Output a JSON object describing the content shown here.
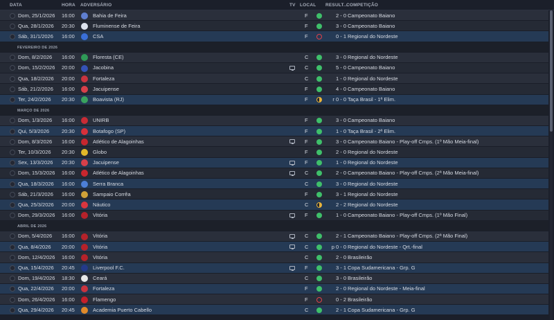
{
  "header": {
    "date": "DATA",
    "time": "HORA",
    "opponent": "ADVERSÁRIO",
    "tv": "TV",
    "local": "LOCAL",
    "result": "RESULT...",
    "competition": "COMPETIÇÃO"
  },
  "colors": {
    "win": "#3fbf6a",
    "draw": "#e7b23a",
    "loss": "#e0424a",
    "highlight_row": "#253a55"
  },
  "rows": [
    {
      "type": "match",
      "date": "Dom, 25/1/2026",
      "time": "16:00",
      "opponent": "Bahia de Feira",
      "badge_color": "#5f7fd0",
      "badge_icon": "crest-icon",
      "tv": false,
      "local": "F",
      "outcome": "win",
      "score": "2 - 0",
      "competition": "Campeonato Baiano"
    },
    {
      "type": "match",
      "date": "Qua, 28/1/2026",
      "time": "20:30",
      "opponent": "Fluminense de Feira",
      "badge_color": "#dce3ee",
      "badge_icon": "crest-icon",
      "tv": false,
      "local": "F",
      "outcome": "win",
      "score": "3 - 0",
      "competition": "Campeonato Baiano"
    },
    {
      "type": "match",
      "date": "Sáb, 31/1/2026",
      "time": "16:00",
      "opponent": "CSA",
      "badge_color": "#3a6fd8",
      "badge_icon": "crest-icon",
      "tv": false,
      "local": "F",
      "outcome": "loss",
      "score": "0 - 1",
      "competition": "Regional do Nordeste",
      "highlight": true
    },
    {
      "type": "month",
      "label": "FEVEREIRO DE 2026"
    },
    {
      "type": "match",
      "date": "Dom, 8/2/2026",
      "time": "16:00",
      "opponent": "Floresta (CE)",
      "badge_color": "#2f9a57",
      "badge_icon": "crest-icon",
      "tv": false,
      "local": "C",
      "outcome": "win",
      "score": "3 - 0",
      "competition": "Regional do Nordeste"
    },
    {
      "type": "match",
      "date": "Dom, 15/2/2026",
      "time": "20:00",
      "opponent": "Jacobina",
      "badge_color": "#3552b5",
      "badge_icon": "crest-icon",
      "tv": true,
      "local": "C",
      "outcome": "win",
      "score": "5 - 0",
      "competition": "Campeonato Baiano"
    },
    {
      "type": "match",
      "date": "Qua, 18/2/2026",
      "time": "20:00",
      "opponent": "Fortaleza",
      "badge_color": "#c9343f",
      "badge_icon": "crest-icon",
      "tv": false,
      "local": "C",
      "outcome": "win",
      "score": "1 - 0",
      "competition": "Regional do Nordeste"
    },
    {
      "type": "match",
      "date": "Sáb, 21/2/2026",
      "time": "16:00",
      "opponent": "Jacuipense",
      "badge_color": "#d8404a",
      "badge_icon": "crest-icon",
      "tv": false,
      "local": "F",
      "outcome": "win",
      "score": "4 - 0",
      "competition": "Campeonato Baiano"
    },
    {
      "type": "match",
      "date": "Ter, 24/2/2026",
      "time": "20:30",
      "opponent": "Boavista (RJ)",
      "badge_color": "#3aa35e",
      "badge_icon": "crest-icon",
      "tv": false,
      "local": "F",
      "outcome": "draw",
      "score": "r 0 - 0",
      "competition": "Taça Brasil - 1ª Elim.",
      "highlight": true
    },
    {
      "type": "month",
      "label": "MARÇO DE 2026"
    },
    {
      "type": "match",
      "date": "Dom, 1/3/2026",
      "time": "16:00",
      "opponent": "UNIRB",
      "badge_color": "#c92c35",
      "badge_icon": "crest-icon",
      "tv": false,
      "local": "F",
      "outcome": "win",
      "score": "3 - 0",
      "competition": "Campeonato Baiano"
    },
    {
      "type": "match",
      "date": "Qui, 5/3/2026",
      "time": "20:30",
      "opponent": "Botafogo (SP)",
      "badge_color": "#d8303a",
      "badge_icon": "crest-icon",
      "tv": false,
      "local": "F",
      "outcome": "win",
      "score": "1 - 0",
      "competition": "Taça Brasil - 2ª Elim.",
      "highlight": true
    },
    {
      "type": "match",
      "date": "Dom, 8/3/2026",
      "time": "16:00",
      "opponent": "Atlético de Alagoinhas",
      "badge_color": "#c8262e",
      "badge_icon": "crest-icon",
      "tv": true,
      "local": "F",
      "outcome": "win",
      "score": "3 - 0",
      "competition": "Campeonato Baiano - Play-off Cmps. (1º Mão Meia-final)"
    },
    {
      "type": "match",
      "date": "Ter, 10/3/2026",
      "time": "20:30",
      "opponent": "Globo",
      "badge_color": "#e1b829",
      "badge_icon": "crest-icon",
      "tv": false,
      "local": "F",
      "outcome": "win",
      "score": "2 - 0",
      "competition": "Regional do Nordeste"
    },
    {
      "type": "match",
      "date": "Sex, 13/3/2026",
      "time": "20:30",
      "opponent": "Jacuipense",
      "badge_color": "#d8404a",
      "badge_icon": "crest-icon",
      "tv": true,
      "local": "F",
      "outcome": "win",
      "score": "1 - 0",
      "competition": "Regional do Nordeste",
      "highlight": true
    },
    {
      "type": "match",
      "date": "Dom, 15/3/2026",
      "time": "16:00",
      "opponent": "Atlético de Alagoinhas",
      "badge_color": "#c8262e",
      "badge_icon": "crest-icon",
      "tv": true,
      "local": "C",
      "outcome": "win",
      "score": "2 - 0",
      "competition": "Campeonato Baiano - Play-off Cmps. (2ª Mão Meia-final)"
    },
    {
      "type": "match",
      "date": "Qua, 18/3/2026",
      "time": "16:00",
      "opponent": "Serra Branca",
      "badge_color": "#4d7fd6",
      "badge_icon": "crest-icon",
      "tv": false,
      "local": "C",
      "outcome": "win",
      "score": "3 - 0",
      "competition": "Regional do Nordeste",
      "highlight": true
    },
    {
      "type": "match",
      "date": "Sáb, 21/3/2026",
      "time": "16:00",
      "opponent": "Sampaio Corrêa",
      "badge_color": "#d0a238",
      "badge_icon": "crest-icon",
      "tv": false,
      "local": "F",
      "outcome": "win",
      "score": "3 - 1",
      "competition": "Regional do Nordeste"
    },
    {
      "type": "match",
      "date": "Qua, 25/3/2026",
      "time": "20:00",
      "opponent": "Náutico",
      "badge_color": "#d9363f",
      "badge_icon": "crest-icon",
      "tv": false,
      "local": "C",
      "outcome": "draw",
      "score": "2 - 2",
      "competition": "Regional do Nordeste",
      "highlight": true
    },
    {
      "type": "match",
      "date": "Dom, 29/3/2026",
      "time": "16:00",
      "opponent": "Vitória",
      "badge_color": "#b5222a",
      "badge_icon": "crest-icon",
      "tv": true,
      "local": "F",
      "outcome": "win",
      "score": "1 - 0",
      "competition": "Campeonato Baiano - Play-off Cmps. (1º Mão Final)"
    },
    {
      "type": "month",
      "label": "ABRIL DE 2026"
    },
    {
      "type": "match",
      "date": "Dom, 5/4/2026",
      "time": "16:00",
      "opponent": "Vitória",
      "badge_color": "#b5222a",
      "badge_icon": "crest-icon",
      "tv": true,
      "local": "C",
      "outcome": "win",
      "score": "2 - 1",
      "competition": "Campeonato Baiano - Play-off Cmps. (2ª Mão Final)"
    },
    {
      "type": "match",
      "date": "Qua, 8/4/2026",
      "time": "20:00",
      "opponent": "Vitória",
      "badge_color": "#b5222a",
      "badge_icon": "crest-icon",
      "tv": true,
      "local": "C",
      "outcome": "win",
      "score": "p 0 - 0",
      "competition": "Regional do Nordeste - Qrt.-final",
      "highlight": true
    },
    {
      "type": "match",
      "date": "Dom, 12/4/2026",
      "time": "16:00",
      "opponent": "Vitória",
      "badge_color": "#b5222a",
      "badge_icon": "crest-icon",
      "tv": false,
      "local": "C",
      "outcome": "win",
      "score": "2 - 0",
      "competition": "Brasileirão"
    },
    {
      "type": "match",
      "date": "Qua, 15/4/2026",
      "time": "20:45",
      "opponent": "Liverpool F.C.",
      "badge_color": "#243a8a",
      "badge_icon": "crest-icon",
      "tv": true,
      "local": "F",
      "outcome": "win",
      "score": "3 - 1",
      "competition": "Copa Sudamericana - Grp. G",
      "highlight": true
    },
    {
      "type": "match",
      "date": "Dom, 19/4/2026",
      "time": "18:30",
      "opponent": "Ceará",
      "badge_color": "#e8e8e8",
      "badge_icon": "crest-icon",
      "tv": false,
      "local": "C",
      "outcome": "win",
      "score": "3 - 0",
      "competition": "Brasileirão"
    },
    {
      "type": "match",
      "date": "Qua, 22/4/2026",
      "time": "20:00",
      "opponent": "Fortaleza",
      "badge_color": "#c9343f",
      "badge_icon": "crest-icon",
      "tv": false,
      "local": "F",
      "outcome": "win",
      "score": "2 - 0",
      "competition": "Regional do Nordeste - Meia-final",
      "highlight": true
    },
    {
      "type": "match",
      "date": "Dom, 26/4/2026",
      "time": "16:00",
      "opponent": "Flamengo",
      "badge_color": "#c4202a",
      "badge_icon": "crest-icon",
      "tv": false,
      "local": "F",
      "outcome": "loss",
      "score": "0 - 2",
      "competition": "Brasileirão"
    },
    {
      "type": "match",
      "date": "Qua, 29/4/2026",
      "time": "20:45",
      "opponent": "Academia Puerto Cabello",
      "badge_color": "#e08a2a",
      "badge_icon": "crest-icon",
      "tv": false,
      "local": "C",
      "outcome": "win",
      "score": "2 - 1",
      "competition": "Copa Sudamericana - Grp. G",
      "highlight": true
    }
  ]
}
